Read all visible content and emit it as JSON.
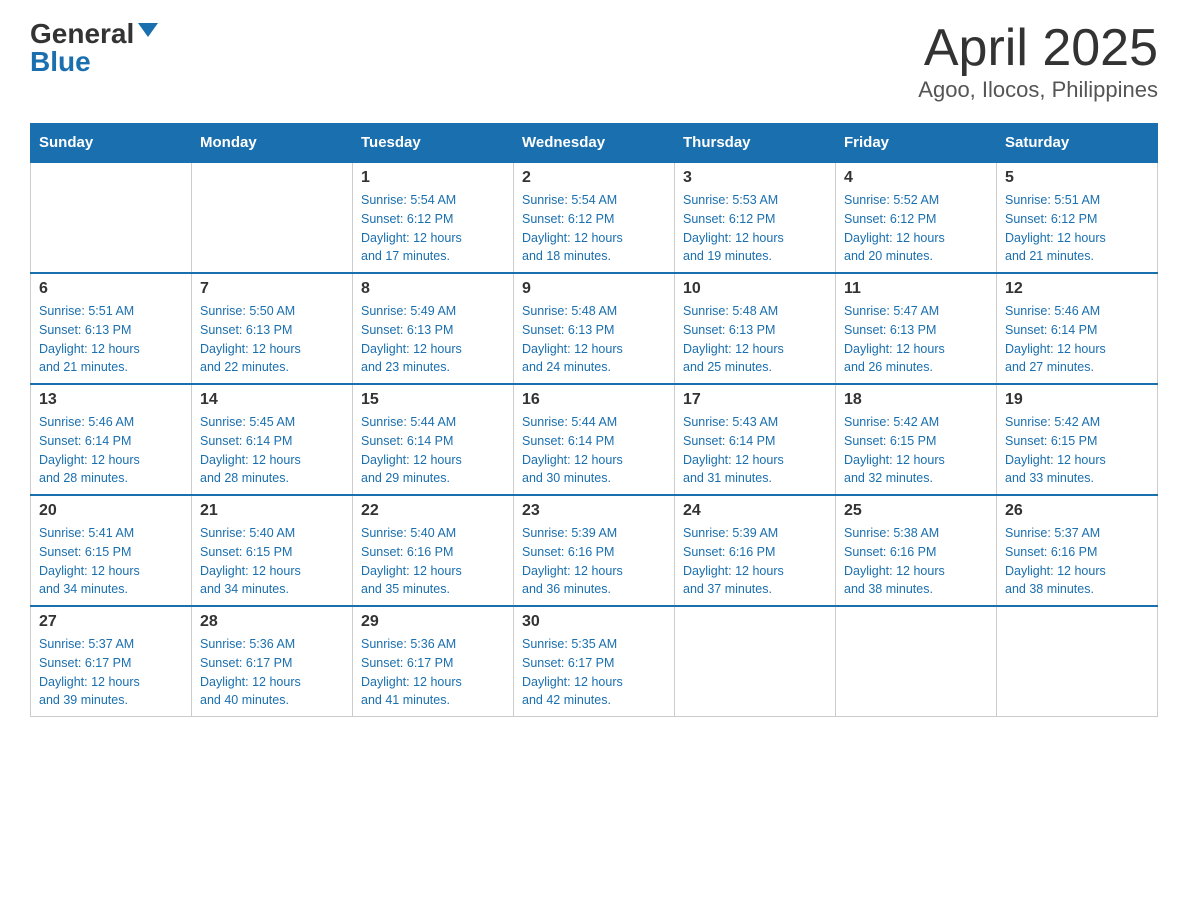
{
  "header": {
    "logo_general": "General",
    "logo_blue": "Blue",
    "title": "April 2025",
    "subtitle": "Agoo, Ilocos, Philippines"
  },
  "calendar": {
    "days_of_week": [
      "Sunday",
      "Monday",
      "Tuesday",
      "Wednesday",
      "Thursday",
      "Friday",
      "Saturday"
    ],
    "weeks": [
      [
        {
          "day": "",
          "info": ""
        },
        {
          "day": "",
          "info": ""
        },
        {
          "day": "1",
          "info": "Sunrise: 5:54 AM\nSunset: 6:12 PM\nDaylight: 12 hours\nand 17 minutes."
        },
        {
          "day": "2",
          "info": "Sunrise: 5:54 AM\nSunset: 6:12 PM\nDaylight: 12 hours\nand 18 minutes."
        },
        {
          "day": "3",
          "info": "Sunrise: 5:53 AM\nSunset: 6:12 PM\nDaylight: 12 hours\nand 19 minutes."
        },
        {
          "day": "4",
          "info": "Sunrise: 5:52 AM\nSunset: 6:12 PM\nDaylight: 12 hours\nand 20 minutes."
        },
        {
          "day": "5",
          "info": "Sunrise: 5:51 AM\nSunset: 6:12 PM\nDaylight: 12 hours\nand 21 minutes."
        }
      ],
      [
        {
          "day": "6",
          "info": "Sunrise: 5:51 AM\nSunset: 6:13 PM\nDaylight: 12 hours\nand 21 minutes."
        },
        {
          "day": "7",
          "info": "Sunrise: 5:50 AM\nSunset: 6:13 PM\nDaylight: 12 hours\nand 22 minutes."
        },
        {
          "day": "8",
          "info": "Sunrise: 5:49 AM\nSunset: 6:13 PM\nDaylight: 12 hours\nand 23 minutes."
        },
        {
          "day": "9",
          "info": "Sunrise: 5:48 AM\nSunset: 6:13 PM\nDaylight: 12 hours\nand 24 minutes."
        },
        {
          "day": "10",
          "info": "Sunrise: 5:48 AM\nSunset: 6:13 PM\nDaylight: 12 hours\nand 25 minutes."
        },
        {
          "day": "11",
          "info": "Sunrise: 5:47 AM\nSunset: 6:13 PM\nDaylight: 12 hours\nand 26 minutes."
        },
        {
          "day": "12",
          "info": "Sunrise: 5:46 AM\nSunset: 6:14 PM\nDaylight: 12 hours\nand 27 minutes."
        }
      ],
      [
        {
          "day": "13",
          "info": "Sunrise: 5:46 AM\nSunset: 6:14 PM\nDaylight: 12 hours\nand 28 minutes."
        },
        {
          "day": "14",
          "info": "Sunrise: 5:45 AM\nSunset: 6:14 PM\nDaylight: 12 hours\nand 28 minutes."
        },
        {
          "day": "15",
          "info": "Sunrise: 5:44 AM\nSunset: 6:14 PM\nDaylight: 12 hours\nand 29 minutes."
        },
        {
          "day": "16",
          "info": "Sunrise: 5:44 AM\nSunset: 6:14 PM\nDaylight: 12 hours\nand 30 minutes."
        },
        {
          "day": "17",
          "info": "Sunrise: 5:43 AM\nSunset: 6:14 PM\nDaylight: 12 hours\nand 31 minutes."
        },
        {
          "day": "18",
          "info": "Sunrise: 5:42 AM\nSunset: 6:15 PM\nDaylight: 12 hours\nand 32 minutes."
        },
        {
          "day": "19",
          "info": "Sunrise: 5:42 AM\nSunset: 6:15 PM\nDaylight: 12 hours\nand 33 minutes."
        }
      ],
      [
        {
          "day": "20",
          "info": "Sunrise: 5:41 AM\nSunset: 6:15 PM\nDaylight: 12 hours\nand 34 minutes."
        },
        {
          "day": "21",
          "info": "Sunrise: 5:40 AM\nSunset: 6:15 PM\nDaylight: 12 hours\nand 34 minutes."
        },
        {
          "day": "22",
          "info": "Sunrise: 5:40 AM\nSunset: 6:16 PM\nDaylight: 12 hours\nand 35 minutes."
        },
        {
          "day": "23",
          "info": "Sunrise: 5:39 AM\nSunset: 6:16 PM\nDaylight: 12 hours\nand 36 minutes."
        },
        {
          "day": "24",
          "info": "Sunrise: 5:39 AM\nSunset: 6:16 PM\nDaylight: 12 hours\nand 37 minutes."
        },
        {
          "day": "25",
          "info": "Sunrise: 5:38 AM\nSunset: 6:16 PM\nDaylight: 12 hours\nand 38 minutes."
        },
        {
          "day": "26",
          "info": "Sunrise: 5:37 AM\nSunset: 6:16 PM\nDaylight: 12 hours\nand 38 minutes."
        }
      ],
      [
        {
          "day": "27",
          "info": "Sunrise: 5:37 AM\nSunset: 6:17 PM\nDaylight: 12 hours\nand 39 minutes."
        },
        {
          "day": "28",
          "info": "Sunrise: 5:36 AM\nSunset: 6:17 PM\nDaylight: 12 hours\nand 40 minutes."
        },
        {
          "day": "29",
          "info": "Sunrise: 5:36 AM\nSunset: 6:17 PM\nDaylight: 12 hours\nand 41 minutes."
        },
        {
          "day": "30",
          "info": "Sunrise: 5:35 AM\nSunset: 6:17 PM\nDaylight: 12 hours\nand 42 minutes."
        },
        {
          "day": "",
          "info": ""
        },
        {
          "day": "",
          "info": ""
        },
        {
          "day": "",
          "info": ""
        }
      ]
    ]
  }
}
